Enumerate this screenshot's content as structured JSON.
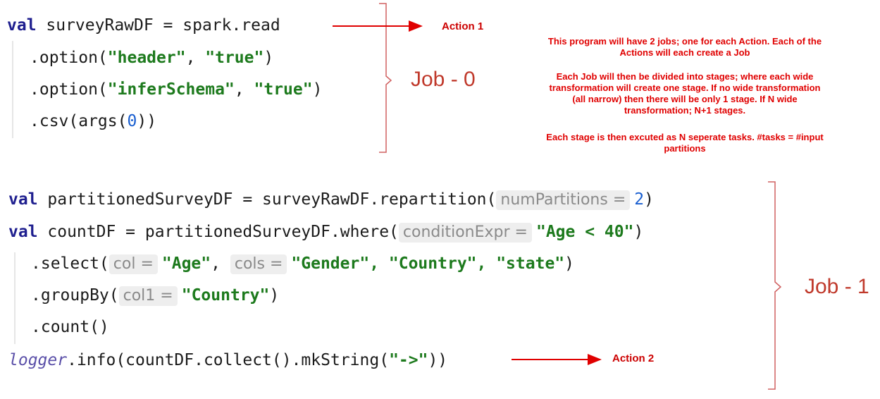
{
  "code": {
    "kw": "val",
    "line1_name": " surveyRawDF = spark.read",
    "line2_a": ".option(",
    "line2_s1": "\"header\"",
    "line2_b": ", ",
    "line2_s2": "\"true\"",
    "line2_c": ")",
    "line3_s1": "\"inferSchema\"",
    "line4_a": ".csv(args(",
    "line4_num": "0",
    "line4_b": "))",
    "line5_a": " partitionedSurveyDF = surveyRawDF.repartition(",
    "line5_hint": "numPartitions =",
    "line5_num": "2",
    "line5_b": ")",
    "line6_a": " countDF = partitionedSurveyDF.where(",
    "line6_hint": "conditionExpr =",
    "line6_str": "\"Age < 40\"",
    "line7_a": ".select(",
    "line7_hint1": "col =",
    "line7_s1": "\"Age\"",
    "line7_comma": ",",
    "line7_hint2": "cols =",
    "line7_s2": "\"Gender\", \"Country\", \"state\"",
    "line8_a": ".groupBy(",
    "line8_hint": "col1 =",
    "line8_s": "\"Country\"",
    "line9": ".count()",
    "line10_logger": "logger",
    "line10_a": ".info(countDF.collect().mkString(",
    "line10_s": "\"->\"",
    "line10_b": "))"
  },
  "labels": {
    "job0": "Job - 0",
    "job1": "Job - 1",
    "action1": "Action 1",
    "action2": "Action 2"
  },
  "notes": {
    "p1": "This program will have 2 jobs; one for each Action. Each of the Actions will each create a Job",
    "p2": "Each Job will then be divided into stages; where each wide transformation will create one stage. If no wide transformation (all narrow) then there will be only 1 stage. If N wide transformation; N+1 stages.",
    "p3": "Each stage is then excuted as N seperate tasks. #tasks = #input partitions"
  },
  "colors": {
    "annotation": "#e00000",
    "keyword": "#1f1f8f",
    "string": "#1d7a1d"
  }
}
